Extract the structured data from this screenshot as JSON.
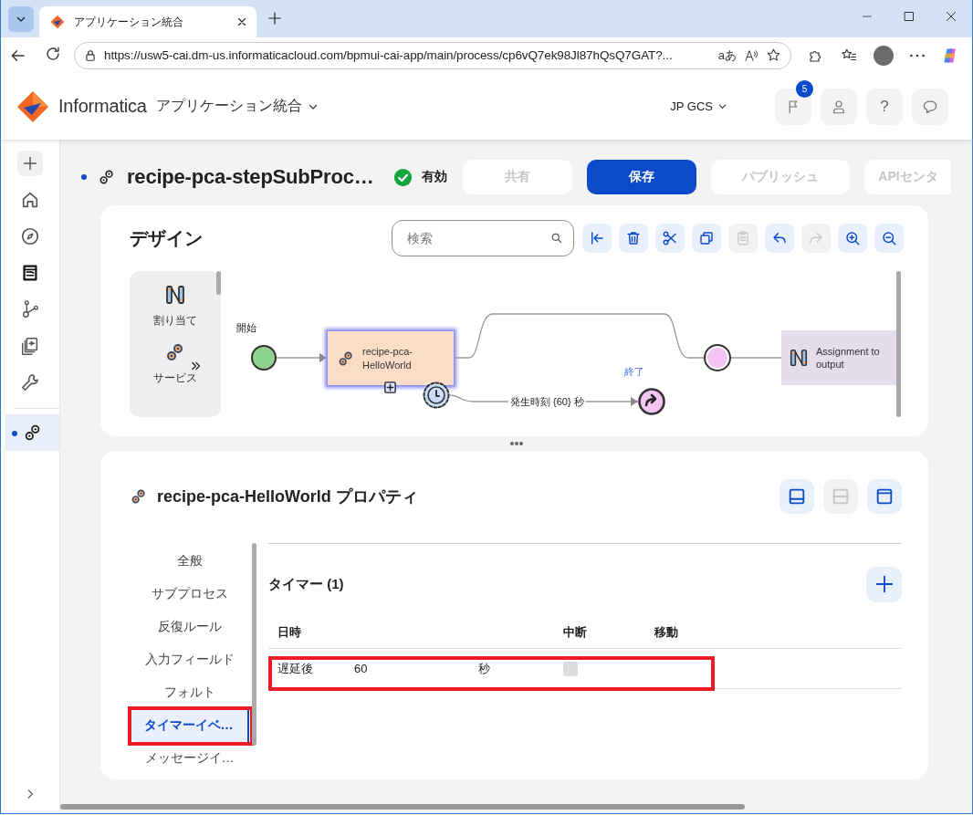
{
  "browser": {
    "tab_title": "アプリケーション統合",
    "url": "https://usw5-cai.dm-us.informaticacloud.com/bpmui-cai-app/main/process/cp6vQ7ek98Jl87hQsQ7GAT?...",
    "translate": "aあ"
  },
  "header": {
    "brand": "Informatica",
    "service": "アプリケーション統合",
    "org": "JP GCS",
    "notifications": "5",
    "help": "?"
  },
  "rail": [
    {
      "kind": "new",
      "selected": false,
      "modified": false
    },
    {
      "kind": "home",
      "selected": false,
      "modified": false
    },
    {
      "kind": "explore",
      "selected": false,
      "modified": false
    },
    {
      "kind": "monitor",
      "selected": false,
      "modified": false
    },
    {
      "kind": "network",
      "selected": false,
      "modified": false
    },
    {
      "kind": "assets",
      "selected": false,
      "modified": false
    },
    {
      "kind": "tools",
      "selected": false,
      "modified": false
    },
    {
      "kind": "process",
      "selected": true,
      "modified": true
    }
  ],
  "process": {
    "modified": true,
    "name": "recipe-pca-stepSubProc…",
    "status": "有効",
    "actions": [
      {
        "label": "共有",
        "kind": "secondary",
        "disabled": true
      },
      {
        "label": "保存",
        "kind": "primary",
        "disabled": false
      },
      {
        "label": "パブリッシュ",
        "kind": "secondary",
        "disabled": true
      },
      {
        "label": "APIセンタ",
        "kind": "secondary",
        "disabled": true
      }
    ]
  },
  "design": {
    "title": "デザイン",
    "search": {
      "placeholder": "検索"
    },
    "tools": [
      {
        "kind": "collapse",
        "disabled": false
      },
      {
        "kind": "delete",
        "disabled": false
      },
      {
        "kind": "cut",
        "disabled": false
      },
      {
        "kind": "copy",
        "disabled": false
      },
      {
        "kind": "paste",
        "disabled": true
      },
      {
        "kind": "undo",
        "disabled": false
      },
      {
        "kind": "redo",
        "disabled": true
      },
      {
        "kind": "zoom_in",
        "disabled": false
      },
      {
        "kind": "zoom_out",
        "disabled": false
      }
    ],
    "palette": [
      {
        "kind": "assignment",
        "label": "割り当て"
      },
      {
        "kind": "service",
        "label": "サービス"
      }
    ],
    "canvas": {
      "start": {
        "label": "開始"
      },
      "task": {
        "label": "recipe-pca-HelloWorld",
        "selected": true
      },
      "timer_flow": {
        "label": "発生時刻 {60} 秒"
      },
      "end_event": {
        "label": "終了"
      },
      "assignment": {
        "label": "Assignment to output"
      }
    }
  },
  "properties": {
    "title": "recipe-pca-HelloWorld プロパティ",
    "layouts": [
      {
        "kind": "bottom",
        "disabled": false
      },
      {
        "kind": "split",
        "disabled": true
      },
      {
        "kind": "top",
        "disabled": false
      }
    ],
    "nav": [
      {
        "label": "全般",
        "selected": false,
        "highlighted": false
      },
      {
        "label": "サブプロセス",
        "selected": false,
        "highlighted": false
      },
      {
        "label": "反復ルール",
        "selected": false,
        "highlighted": false
      },
      {
        "label": "入力フィールド",
        "selected": false,
        "highlighted": false
      },
      {
        "label": "フォルト",
        "selected": false,
        "highlighted": false
      },
      {
        "label": "タイマーイベ…",
        "selected": true,
        "highlighted": true
      },
      {
        "label": "メッセージイ…",
        "selected": false,
        "highlighted": false
      }
    ],
    "timers": {
      "title": "タイマー (1)",
      "columns": [
        "日時",
        "中断",
        "移動"
      ],
      "rows": [
        {
          "type": "遅延後",
          "value": "60",
          "unit": "秒",
          "interrupting": false,
          "highlighted": true
        }
      ]
    }
  }
}
